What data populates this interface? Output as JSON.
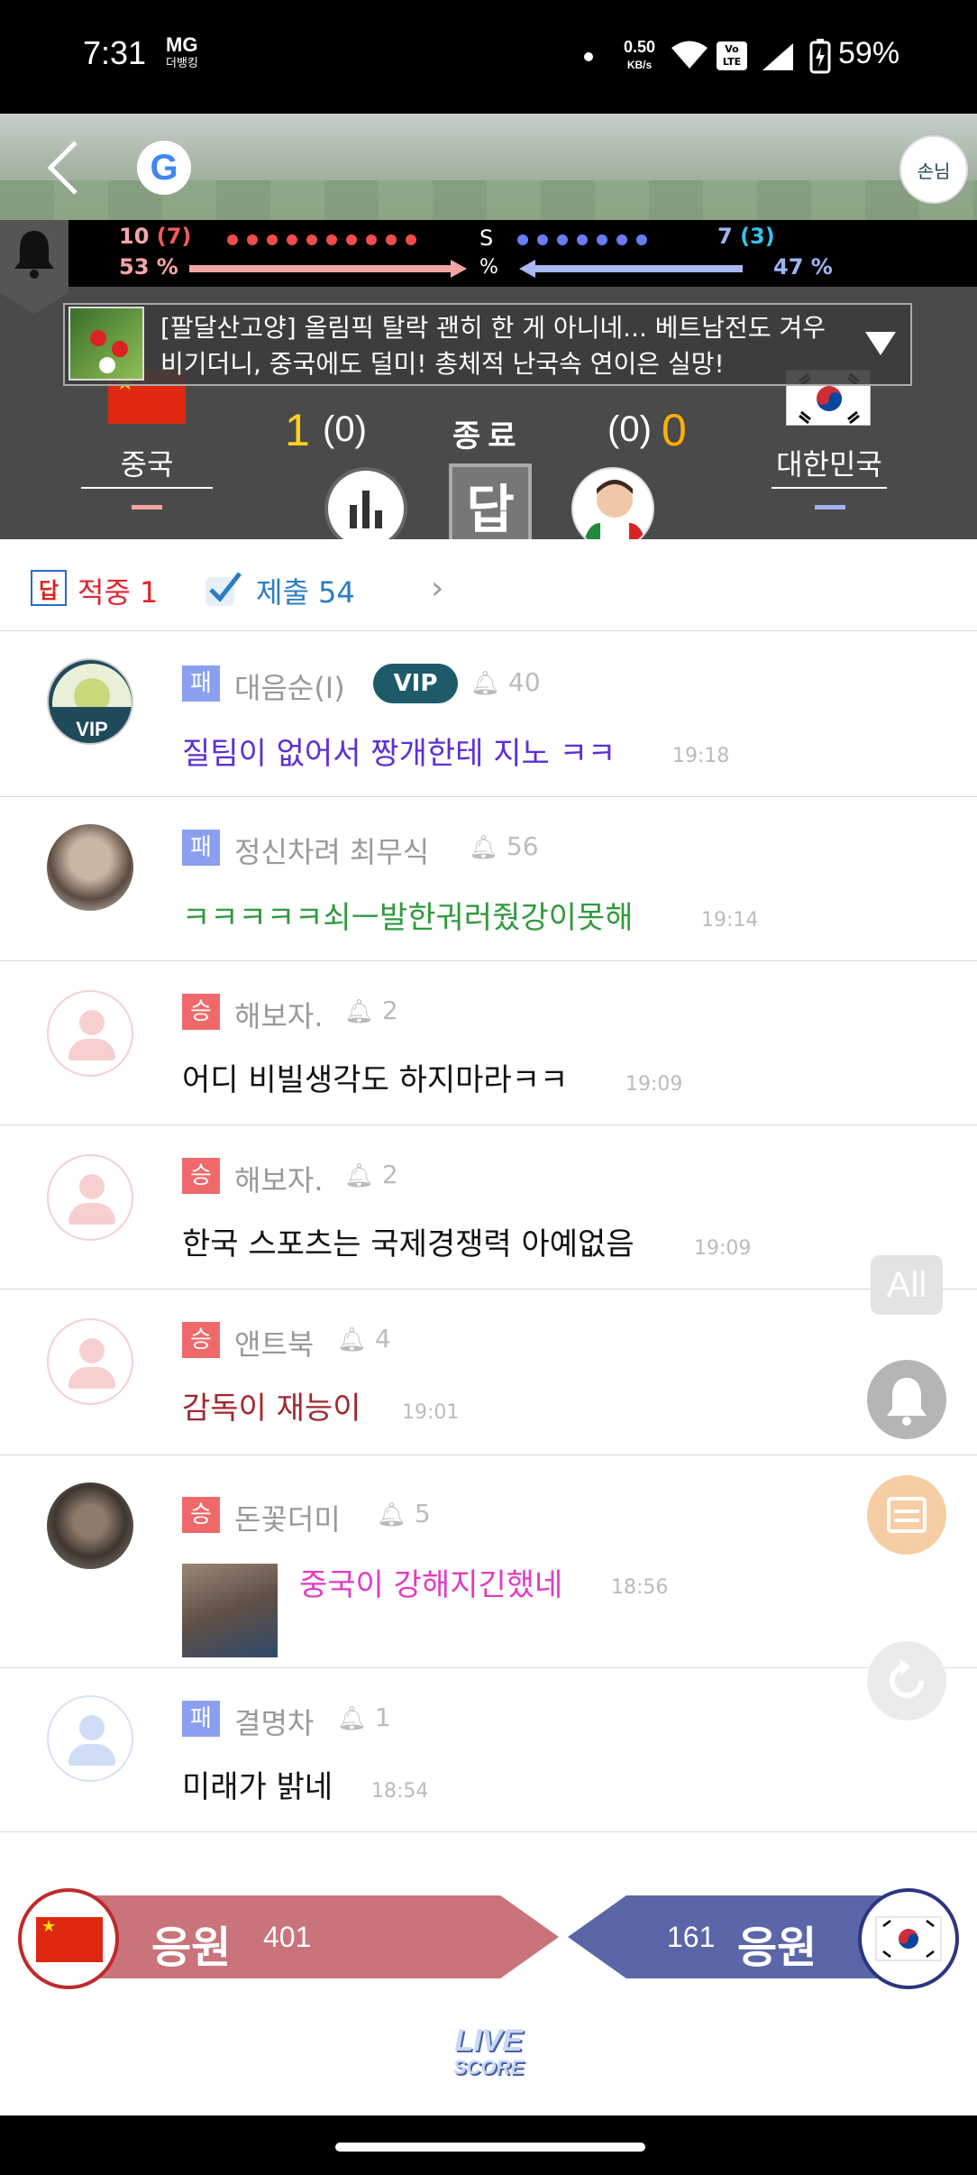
{
  "status_bar": {
    "time": "7:31",
    "carrier": "MG",
    "carrier_sub": "더뱅킹",
    "speed": "0.50",
    "speed_unit": "KB/s",
    "volte": "Vo LTE",
    "battery": "59%"
  },
  "header": {
    "guest_label": "손님",
    "home_stats": {
      "shots": "10",
      "on_target": "(7)",
      "possession": "53 %"
    },
    "away_stats": {
      "shots": "7",
      "on_target": "(3)",
      "possession": "47 %"
    },
    "shots_label": "S",
    "pct_label": "%",
    "news": "[팔달산고양] 올림픽 탈락 괜히 한 게 아니네... 베트남전도 겨우 비기더니, 중국에도 덜미! 총체적 난국속 연이은 실망!",
    "home_team": "중국",
    "away_team": "대한민국",
    "home_score": "1",
    "home_score_paren": "(0)",
    "away_score_paren": "(0)",
    "away_score": "0",
    "status": "종료",
    "answer_label": "답"
  },
  "tabs": {
    "hit_icon": "답",
    "hit_label": "적중 1",
    "submit_label": "제출 54",
    "chevron": "›"
  },
  "comments": [
    {
      "result": "패",
      "nickname": "대음순(I)",
      "vip": "VIP",
      "likes": "40",
      "message": "질팀이 없어서 짱개한테 지노 ㅋㅋ",
      "time": "19:18",
      "color": "#5b2fd6"
    },
    {
      "result": "패",
      "nickname": "정신차려 최무식",
      "likes": "56",
      "message": "ㅋㅋㅋㅋㅋ쇠ㅡ발한궈러줬강이못해",
      "time": "19:14",
      "color": "#2f9a3c"
    },
    {
      "result": "승",
      "nickname": "해보자.",
      "likes": "2",
      "message": "어디 비빌생각도 하지마라ㅋㅋ",
      "time": "19:09",
      "color": "#111111"
    },
    {
      "result": "승",
      "nickname": "해보자.",
      "likes": "2",
      "message": "한국 스포츠는 국제경쟁력 아예없음",
      "time": "19:09",
      "color": "#111111"
    },
    {
      "result": "승",
      "nickname": "앤트북",
      "likes": "4",
      "message": "감독이 재능이",
      "time": "19:01",
      "color": "#a3262e"
    },
    {
      "result": "승",
      "nickname": "돈꽃더미",
      "likes": "5",
      "message": "중국이 강해지긴했네",
      "time": "18:56",
      "color": "#e23bc2"
    },
    {
      "result": "패",
      "nickname": "결명차",
      "likes": "1",
      "message": "미래가 밝네",
      "time": "18:54",
      "color": "#111111"
    }
  ],
  "floating": {
    "all": "All"
  },
  "cheer": {
    "home_label": "응원",
    "home_count": "401",
    "away_label": "응원",
    "away_count": "161"
  },
  "footer": {
    "logo_top": "LIVE",
    "logo_bottom": "SCORE"
  },
  "colors": {
    "header_bg": "#4a4a4a",
    "win": "#f0696a",
    "lose": "#8aa0ee",
    "cheer_home": "#c9747a",
    "cheer_away": "#5b66a8"
  }
}
